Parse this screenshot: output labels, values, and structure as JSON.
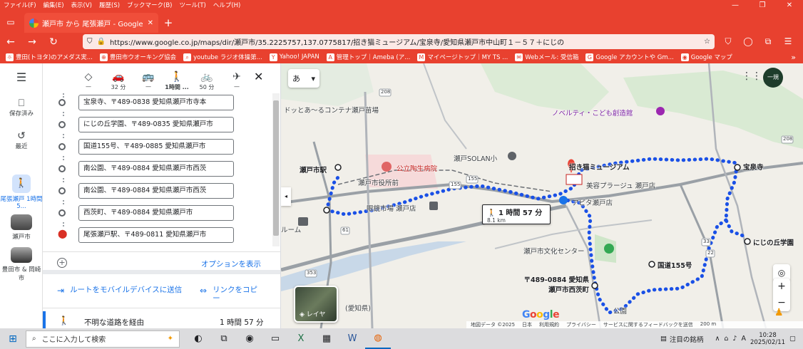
{
  "menubar": {
    "items": [
      "ファイル(F)",
      "編集(E)",
      "表示(V)",
      "履歴(S)",
      "ブックマーク(B)",
      "ツール(T)",
      "ヘルプ(H)"
    ]
  },
  "tab": {
    "title": "瀬戸市 から 尾張瀬戸 - Google マップ"
  },
  "url": "https://www.google.co.jp/maps/dir/瀬戸市/35.2225757,137.0775817/招き猫ミュージアム/宝泉寺/愛知県瀬戸市中山町１－５７＋にじの",
  "bookmarks": [
    "豊田(トヨタ)のアメダス実...",
    "豊田市ウオーキング協会",
    "youtube ラジオ体操第...",
    "Yahoo! JAPAN",
    "管理トップ｜Ameba (ア...",
    "マイページトップ｜MY TS ...",
    "Webメール: 受信箱",
    "Google アカウントや Gm...",
    "Google マップ"
  ],
  "rail": {
    "saved": "保存済み",
    "recent": "最近",
    "walk": "尾張瀬戸 1時間 5...",
    "seto": "瀬戸市",
    "toyota": "豊田市 & 岡崎市"
  },
  "modes": [
    {
      "icon": "◇",
      "label": "—"
    },
    {
      "icon": "🚗",
      "label": "32 分"
    },
    {
      "icon": "🚌",
      "label": "—"
    },
    {
      "icon": "🚶",
      "label": "1時間 ..."
    },
    {
      "icon": "🚲",
      "label": "50 分"
    },
    {
      "icon": "✈",
      "label": "—"
    }
  ],
  "waypoints": [
    "宝泉寺、〒489-0838 愛知県瀬戸市寺本",
    "にじの丘学園、〒489-0835 愛知県瀬戸市",
    "国道155号、〒489-0885 愛知県瀬戸市",
    "南公園、〒489-0884 愛知県瀬戸市西茨",
    "南公園、〒489-0884 愛知県瀬戸市西茨",
    "西茨町、〒489-0884 愛知県瀬戸市",
    "尾張瀬戸駅、〒489-0811 愛知県瀬戸市"
  ],
  "options": {
    "show": "オプションを表示"
  },
  "send": {
    "mobile": "ルートをモバイルデバイスに送信",
    "copy": "リンクをコピー"
  },
  "route": {
    "desc": "不明な道路を経由",
    "time": "1 時間 57 分"
  },
  "map": {
    "lang": "あ",
    "avatar": "一規",
    "callout_time": "1 時間 57 分",
    "callout_dist": "8.1 km",
    "layer": "レイヤ",
    "labels": {
      "nursery": "ドッとあ〜るコンテナ瀬戸苗場",
      "novelty": "ノベルティ・こども創造館",
      "solan": "瀬戸SOLAN小",
      "maneki": "招き猫ミュージアム",
      "hosenji": "宝泉寺",
      "station": "瀬戸市駅",
      "hospital": "公立陶生病院",
      "cityhall": "瀬戸市役所前",
      "optician": "眼鏡市場 瀬戸店",
      "miyoshi": "美容プラージュ 瀬戸店",
      "apita": "アピタ瀬戸店",
      "room": "ルーム",
      "niji": "にじの丘学園",
      "culture": "瀬戸市文化センター",
      "kokudo": "国道155号",
      "nishiibara": "〒489-0884 愛知県瀬戸市西茨町",
      "aichi": "(愛知県)",
      "park": "公園"
    },
    "roads": [
      "208",
      "155",
      "155",
      "61",
      "33",
      "22",
      "353",
      "208",
      "155"
    ],
    "footer": [
      "地図データ ©2025",
      "日本",
      "利用規約",
      "プライバシー",
      "サービスに関するフィードバックを送信",
      "200 m"
    ]
  },
  "taskbar": {
    "search": "ここに入力して検索",
    "news": "注目の銘柄",
    "ime": "A",
    "time": "10:28",
    "date": "2025/02/11"
  }
}
